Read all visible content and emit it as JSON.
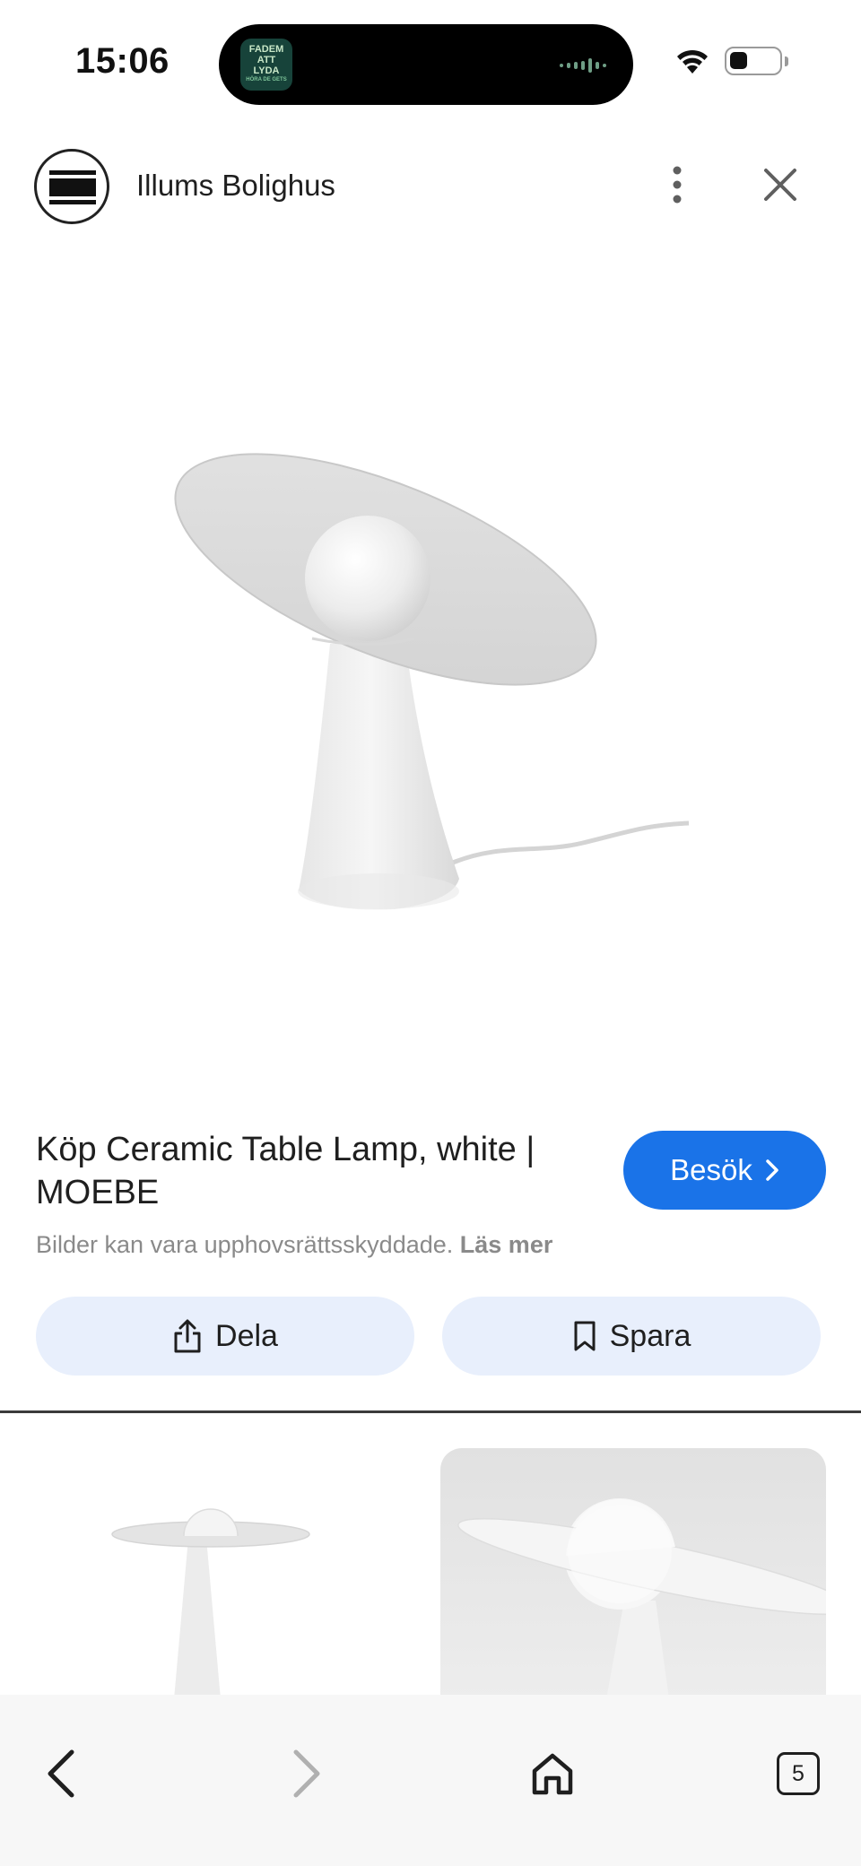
{
  "status_bar": {
    "time": "15:06",
    "island_app_lines": [
      "FADEM",
      "ATT",
      "LYDA",
      "HÖRA DE GETS"
    ],
    "battery_level": 0.35
  },
  "header": {
    "site_name": "Illums Bolighus",
    "logo_icon": "illums-bolighus-logo",
    "more_icon": "more-vert-icon",
    "close_icon": "close-icon"
  },
  "result": {
    "title": "Köp Ceramic Table Lamp, white | MOEBE",
    "visit_label": "Besök",
    "copyright_text": "Bilder kan vara upphovsrättsskyddade.",
    "learn_more": "Läs mer"
  },
  "actions": {
    "share_label": "Dela",
    "save_label": "Spara"
  },
  "bottom_nav": {
    "tab_count": "5"
  },
  "colors": {
    "accent": "#1a73e8",
    "action_bg": "#e8effc"
  }
}
